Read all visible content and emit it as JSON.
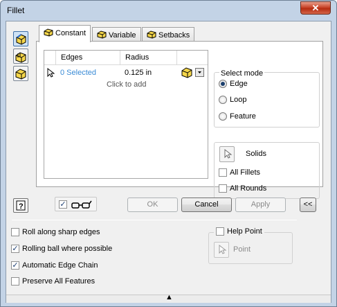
{
  "window": {
    "title": "Fillet",
    "close_glyph": "✕"
  },
  "sidebar": {
    "icons": [
      "fillet-icon",
      "face-fillet-icon",
      "full-round-fillet-icon"
    ]
  },
  "tabs": [
    {
      "label": "Constant",
      "icon": "fillet-tab-icon",
      "active": true
    },
    {
      "label": "Variable",
      "icon": "variable-tab-icon",
      "active": false
    },
    {
      "label": "Setbacks",
      "icon": "setbacks-tab-icon",
      "active": false
    }
  ],
  "grid": {
    "columns": [
      "Edges",
      "Radius"
    ],
    "rows": [
      {
        "edges": "0 Selected",
        "radius": "0.125 in"
      }
    ],
    "add_row_text": "Click to add"
  },
  "select_mode": {
    "title": "Select mode",
    "options": [
      {
        "label": "Edge",
        "selected": true
      },
      {
        "label": "Loop",
        "selected": false
      },
      {
        "label": "Feature",
        "selected": false
      }
    ]
  },
  "solids": {
    "label": "Solids",
    "all_fillets": {
      "label": "All Fillets",
      "checked": false
    },
    "all_rounds": {
      "label": "All Rounds",
      "checked": false
    }
  },
  "bottom_bar": {
    "preview_checked": true,
    "ok_label": "OK",
    "cancel_label": "Cancel",
    "apply_label": "Apply",
    "more_label": "<<"
  },
  "options": [
    {
      "label": "Roll along sharp edges",
      "checked": false
    },
    {
      "label": "Rolling ball where possible",
      "checked": true
    },
    {
      "label": "Automatic Edge Chain",
      "checked": true
    },
    {
      "label": "Preserve All Features",
      "checked": false
    }
  ],
  "help_point": {
    "label": "Help Point",
    "checked": false,
    "point_label": "Point"
  },
  "footer": {
    "collapse_glyph": "▲"
  },
  "colors": {
    "accent": "#3d7bd4",
    "link": "#3a8bd6",
    "face": "#f5d64a"
  }
}
